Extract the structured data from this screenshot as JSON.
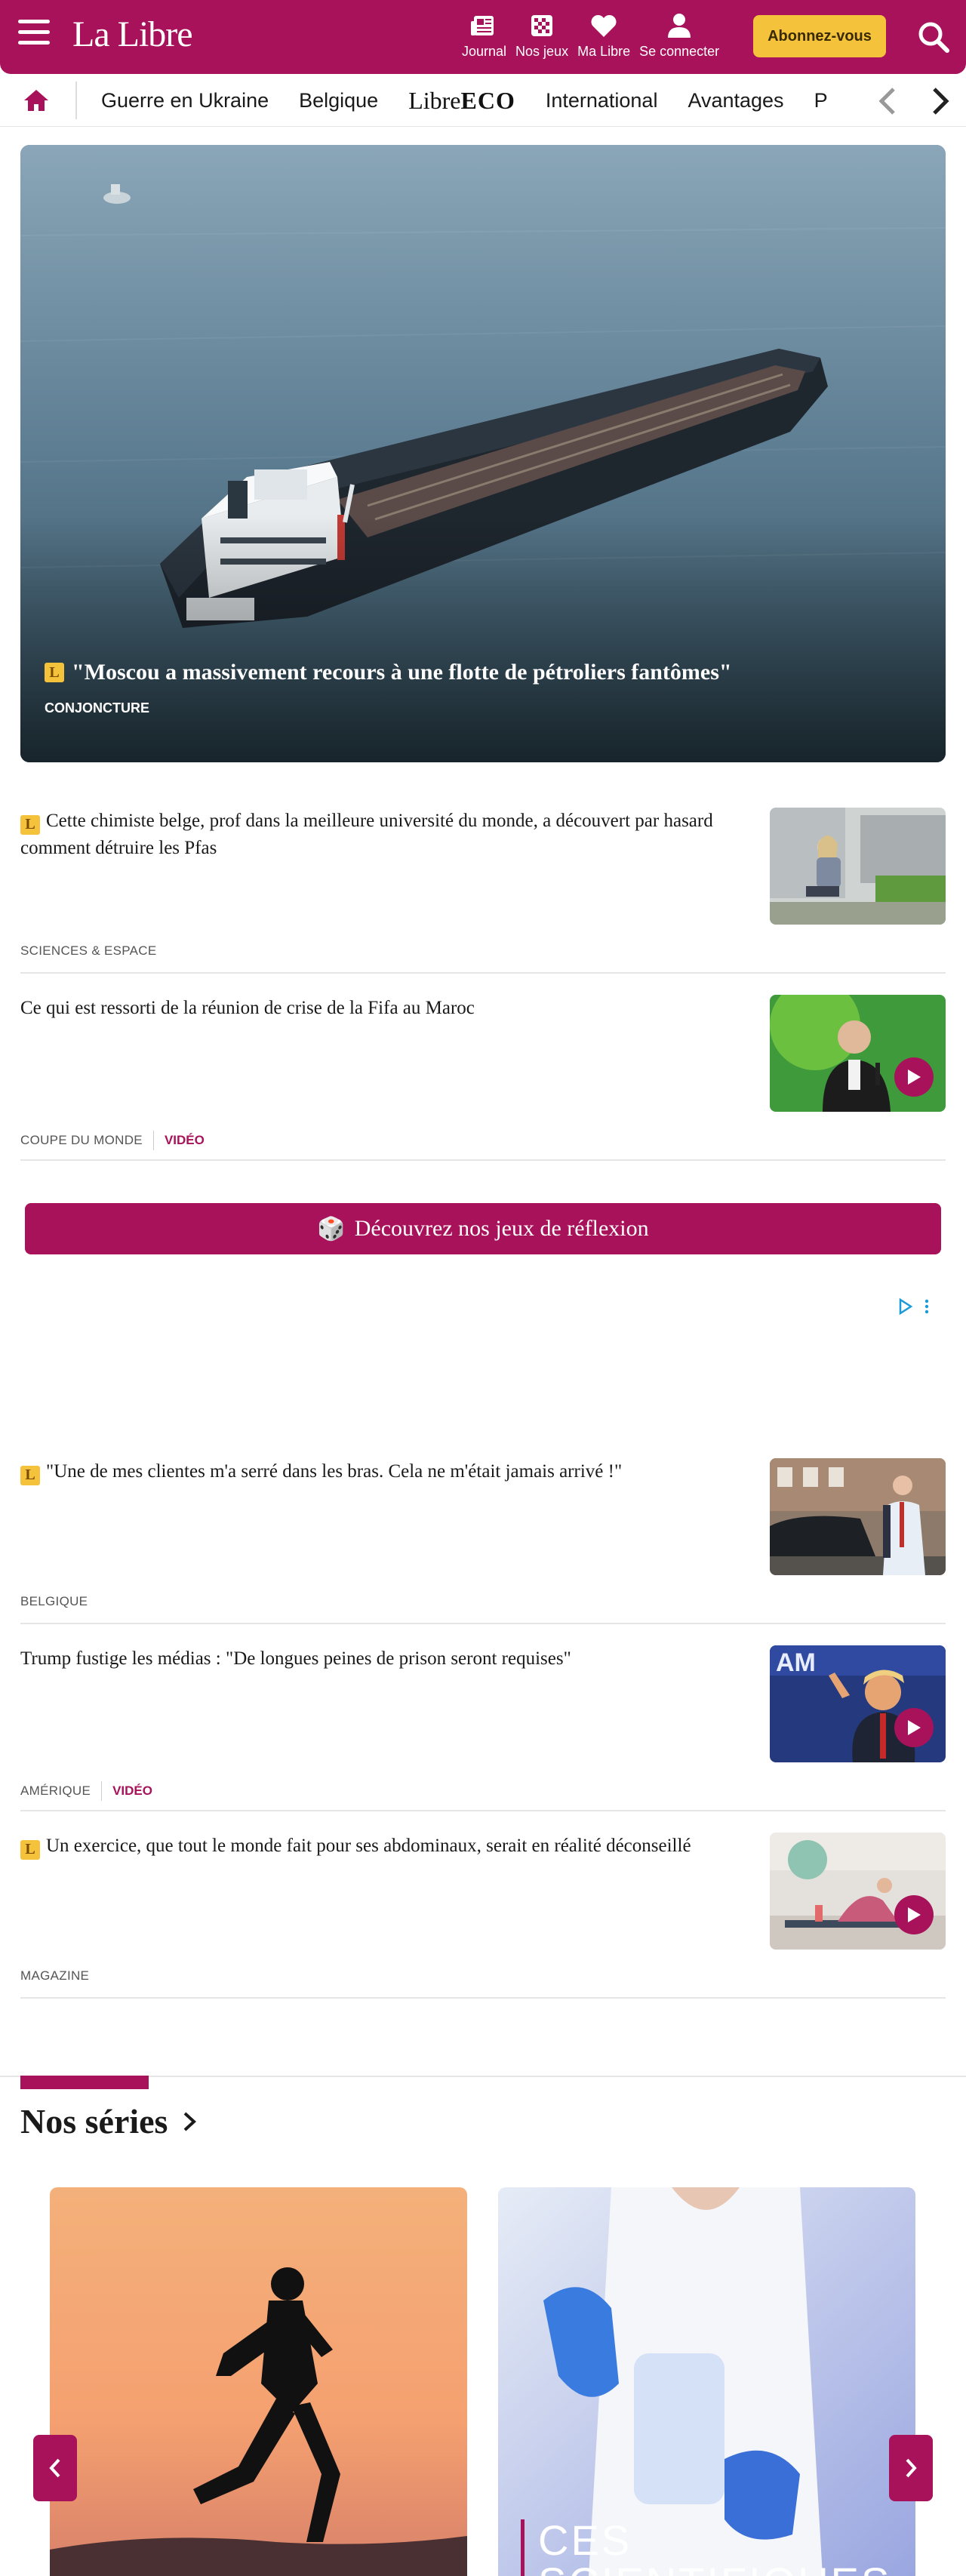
{
  "header": {
    "logo": "La Libre",
    "items": [
      {
        "label": "Journal",
        "icon": "newspaper-icon"
      },
      {
        "label": "Nos jeux",
        "icon": "grid-icon"
      },
      {
        "label": "Ma Libre",
        "icon": "heart-icon"
      },
      {
        "label": "Se connecter",
        "icon": "user-icon"
      }
    ],
    "subscribe_label": "Abonnez-vous",
    "colors": {
      "brand": "#a8125a",
      "accent": "#f5c33b"
    }
  },
  "nav": {
    "links": [
      "Guerre en Ukraine",
      "Belgique",
      "International",
      "Avantages",
      "P"
    ],
    "eco": {
      "prefix": "Libre",
      "suffix": "ECO"
    }
  },
  "hero": {
    "badge": "L",
    "title": "\"Moscou a massivement recours à une flotte de pétroliers fantômes\"",
    "category": "CONJONCTURE"
  },
  "articles": [
    {
      "badge": "L",
      "title": "Cette chimiste belge, prof dans la meilleure université du monde, a découvert par hasard comment détruire les Pfas",
      "category": "SCIENCES & ESPACE",
      "video": ""
    },
    {
      "badge": "",
      "title": "Ce qui est ressorti de la réunion de crise de la Fifa au Maroc",
      "category": "COUPE DU MONDE",
      "video": "VIDÉO"
    },
    {
      "badge": "L",
      "title": "\"Une de mes clientes m'a serré dans les bras. Cela ne m'était jamais arrivé !\"",
      "category": "BELGIQUE",
      "video": ""
    },
    {
      "badge": "",
      "title": "Trump fustige les médias : \"De longues peines de prison seront requises\"",
      "category": "AMÉRIQUE",
      "video": "VIDÉO"
    },
    {
      "badge": "L",
      "title": "Un exercice, que tout le monde fait pour ses abdominaux, serait en réalité déconseillé",
      "category": "MAGAZINE",
      "video": ""
    }
  ],
  "games_banner": {
    "emoji": "🎲",
    "label": "Découvrez nos jeux de réflexion"
  },
  "series": {
    "title": "Nos séries",
    "card2_label_line1": "CES",
    "card2_label_line2": "SCIENTIFIQUES"
  }
}
